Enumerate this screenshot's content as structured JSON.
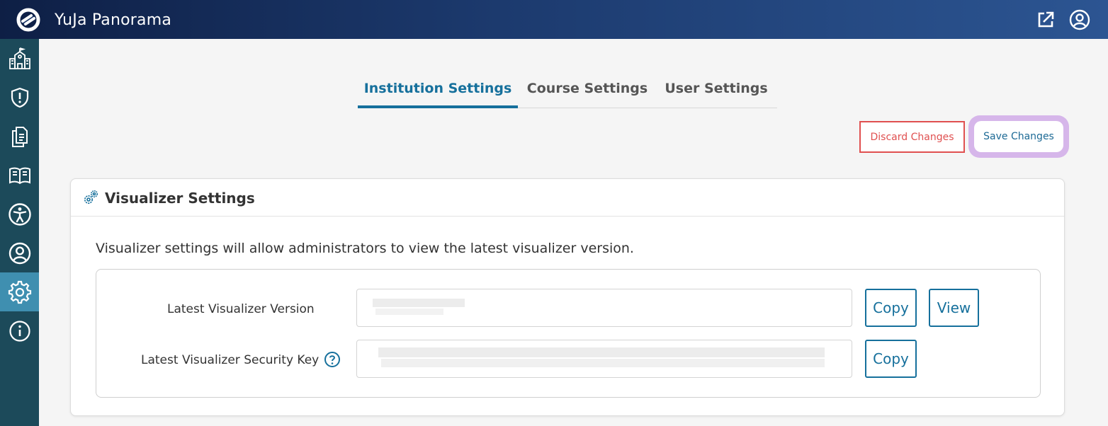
{
  "app": {
    "title": "YuJa Panorama"
  },
  "icons": {
    "logo": "yuja-logo-icon",
    "external_link": "external-link-icon",
    "user": "user-circle-icon"
  },
  "sidebar": {
    "items": [
      {
        "name": "institution",
        "icon": "school-building-icon"
      },
      {
        "name": "security",
        "icon": "shield-alert-icon"
      },
      {
        "name": "documents",
        "icon": "documents-icon"
      },
      {
        "name": "library",
        "icon": "open-book-icon"
      },
      {
        "name": "accessibility",
        "icon": "accessibility-icon"
      },
      {
        "name": "users",
        "icon": "user-circle-icon"
      },
      {
        "name": "settings",
        "icon": "gear-icon",
        "active": true
      },
      {
        "name": "info",
        "icon": "info-icon"
      }
    ]
  },
  "tabs": [
    {
      "label": "Institution Settings",
      "active": true
    },
    {
      "label": "Course Settings",
      "active": false
    },
    {
      "label": "User Settings",
      "active": false
    }
  ],
  "actions": {
    "discard_label": "Discard Changes",
    "save_label": "Save Changes"
  },
  "card": {
    "title": "Visualizer Settings",
    "description": "Visualizer settings will allow administrators to view the latest visualizer version.",
    "fields": [
      {
        "label": "Latest Visualizer Version",
        "value": "",
        "copy_label": "Copy",
        "view_label": "View"
      },
      {
        "label": "Latest Visualizer Security Key",
        "value": "",
        "copy_label": "Copy",
        "help_icon": "question-circle-icon"
      }
    ]
  },
  "colors": {
    "accent": "#16709c",
    "danger": "#e05050",
    "sidebar": "#1c4a5a",
    "sidebar_active": "#3f8fb0",
    "highlight_ring": "#d6b6ea"
  }
}
